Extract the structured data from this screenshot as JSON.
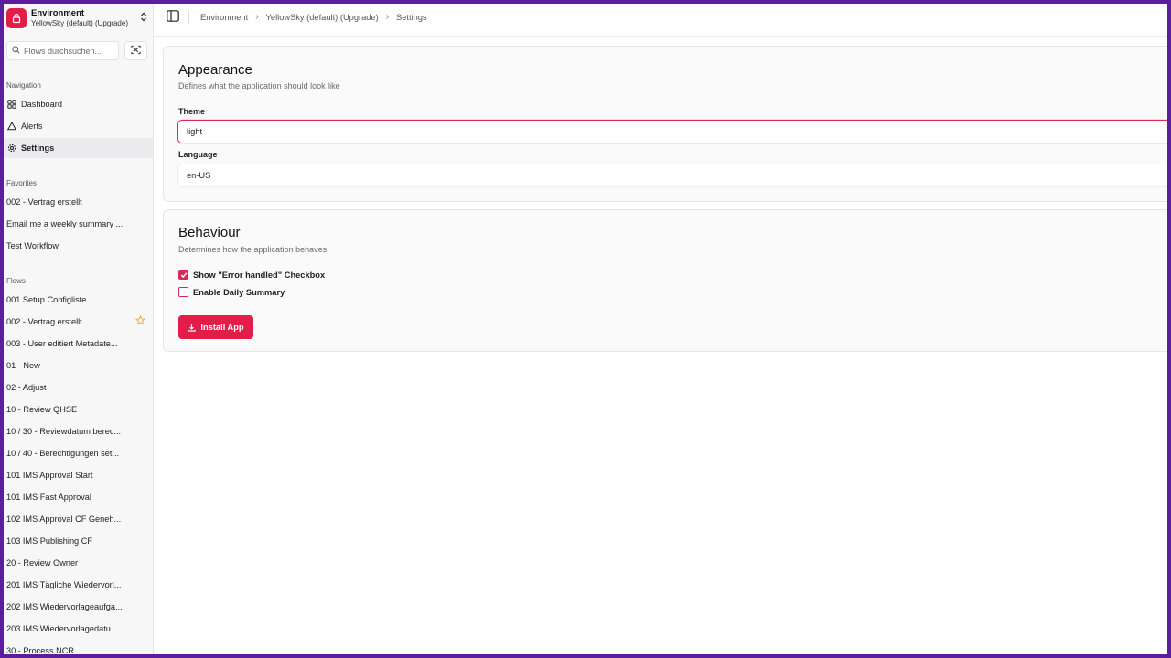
{
  "environment": {
    "title": "Environment",
    "subtitle": "YellowSky (default) (Upgrade)"
  },
  "search": {
    "placeholder": "Flows durchsuchen..."
  },
  "sidebar": {
    "navigation_label": "Navigation",
    "nav_items": [
      {
        "label": "Dashboard",
        "icon": "dashboard-icon"
      },
      {
        "label": "Alerts",
        "icon": "alert-triangle-icon"
      },
      {
        "label": "Settings",
        "icon": "gear-icon",
        "active": true
      }
    ],
    "favorites_label": "Favorites",
    "favorites": [
      "002 - Vertrag erstellt",
      "Email me a weekly summary ...",
      "Test Workflow"
    ],
    "flows_label": "Flows",
    "flows": [
      "001 Setup Configliste",
      "002 - Vertrag erstellt",
      "003 - User editiert Metadate...",
      "01 - New",
      "02 - Adjust",
      "10 - Review QHSE",
      "10 / 30 - Reviewdatum berec...",
      "10 / 40 - Berechtigungen set...",
      "101 IMS Approval Start",
      "101 IMS Fast Approval",
      "102 IMS Approval CF Geneh...",
      "103 IMS Publishing CF",
      "20 - Review Owner",
      "201 IMS Tägliche Wiedervorl...",
      "202 IMS Wiedervorlageaufga...",
      "203 IMS Wiedervorlagedatu...",
      "30 - Process NCR"
    ]
  },
  "breadcrumb": [
    "Environment",
    "YellowSky (default) (Upgrade)",
    "Settings"
  ],
  "appearance": {
    "title": "Appearance",
    "description": "Defines what the application should look like",
    "theme_label": "Theme",
    "theme_value": "light",
    "language_label": "Language",
    "language_value": "en-US"
  },
  "behaviour": {
    "title": "Behaviour",
    "description": "Determines how the application behaves",
    "checkboxes": [
      {
        "label": "Show \"Error handled\" Checkbox",
        "checked": true
      },
      {
        "label": "Enable Daily Summary",
        "checked": false
      }
    ],
    "install_label": "Install App"
  },
  "colors": {
    "accent": "#e11d48",
    "frame": "#5b1e9e",
    "star": "#f5a524"
  }
}
